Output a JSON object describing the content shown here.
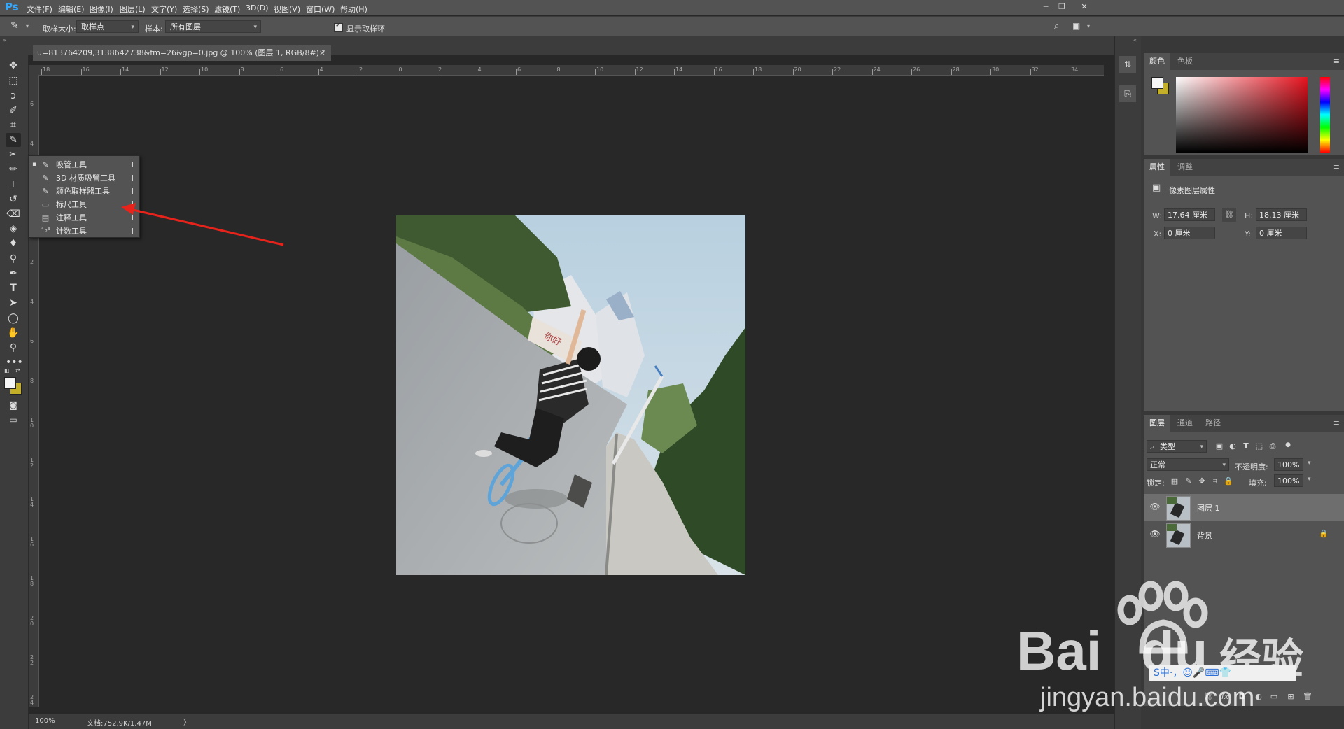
{
  "app": {
    "logo": "Ps"
  },
  "menu": [
    "文件(F)",
    "编辑(E)",
    "图像(I)",
    "图层(L)",
    "文字(Y)",
    "选择(S)",
    "滤镜(T)",
    "3D(D)",
    "视图(V)",
    "窗口(W)",
    "帮助(H)"
  ],
  "options": {
    "sample_size_label": "取样大小:",
    "sample_size_value": "取样点",
    "sample_label": "样本:",
    "sample_value": "所有图层",
    "show_ring_label": "显示取样环",
    "show_ring_checked": true
  },
  "document": {
    "tab_title": "u=813764209,3138642738&fm=26&gp=0.jpg @ 100% (图层 1, RGB/8#) *",
    "close": "×"
  },
  "ruler": {
    "h_ticks": [
      "18",
      "16",
      "14",
      "12",
      "10",
      "8",
      "6",
      "4",
      "2",
      "0",
      "2",
      "4",
      "6",
      "8",
      "10",
      "12",
      "14",
      "16",
      "18",
      "20",
      "22",
      "24",
      "26",
      "28",
      "30",
      "32",
      "34"
    ],
    "v_ticks": [
      "6",
      "4",
      "2",
      "0",
      "2",
      "4",
      "6",
      "8",
      "1\n0",
      "1\n2",
      "1\n4",
      "1\n6",
      "1\n8",
      "2\n0",
      "2\n2",
      "2\n4"
    ]
  },
  "flyout": {
    "items": [
      {
        "icon": "eyedropper-icon",
        "label": "吸管工具",
        "key": "I",
        "active": true
      },
      {
        "icon": "3d-material-eyedropper-icon",
        "label": "3D 材质吸管工具",
        "key": "I"
      },
      {
        "icon": "color-sampler-icon",
        "label": "颜色取样器工具",
        "key": "I"
      },
      {
        "icon": "ruler-icon",
        "label": "标尺工具",
        "key": "I"
      },
      {
        "icon": "note-icon",
        "label": "注释工具",
        "key": "I"
      },
      {
        "icon": "count-icon",
        "label": "计数工具",
        "key": "I"
      }
    ]
  },
  "status": {
    "zoom": "100%",
    "doc": "文档:752.9K/1.47M",
    "arrow": "〉"
  },
  "panels": {
    "color": {
      "tabs": [
        "颜色",
        "色板"
      ]
    },
    "properties": {
      "tabs": [
        "属性",
        "调整"
      ],
      "title": "像素图层属性",
      "w_label": "W:",
      "w_value": "17.64 厘米",
      "h_label": "H:",
      "h_value": "18.13 厘米",
      "x_label": "X:",
      "x_value": "0 厘米",
      "y_label": "Y:",
      "y_value": "0 厘米"
    },
    "layers": {
      "tabs": [
        "图层",
        "通道",
        "路径"
      ],
      "filter_value": "类型",
      "blend_mode": "正常",
      "opacity_label": "不透明度:",
      "opacity_value": "100%",
      "lock_label": "锁定:",
      "fill_label": "填充:",
      "fill_value": "100%",
      "layers": [
        {
          "name": "图层 1",
          "selected": true
        },
        {
          "name": "背景",
          "locked": true
        }
      ]
    }
  },
  "watermark": {
    "brand": "Bai",
    "brand2": "du",
    "cn": "经验",
    "url": "jingyan.baidu.com",
    "ime": "S中·，☺🎤⌨👕"
  },
  "colors": {
    "fg": "#f5f5f5",
    "bg": "#c4b028",
    "accent": "#31a8ff",
    "arrow": "#e8231b"
  }
}
